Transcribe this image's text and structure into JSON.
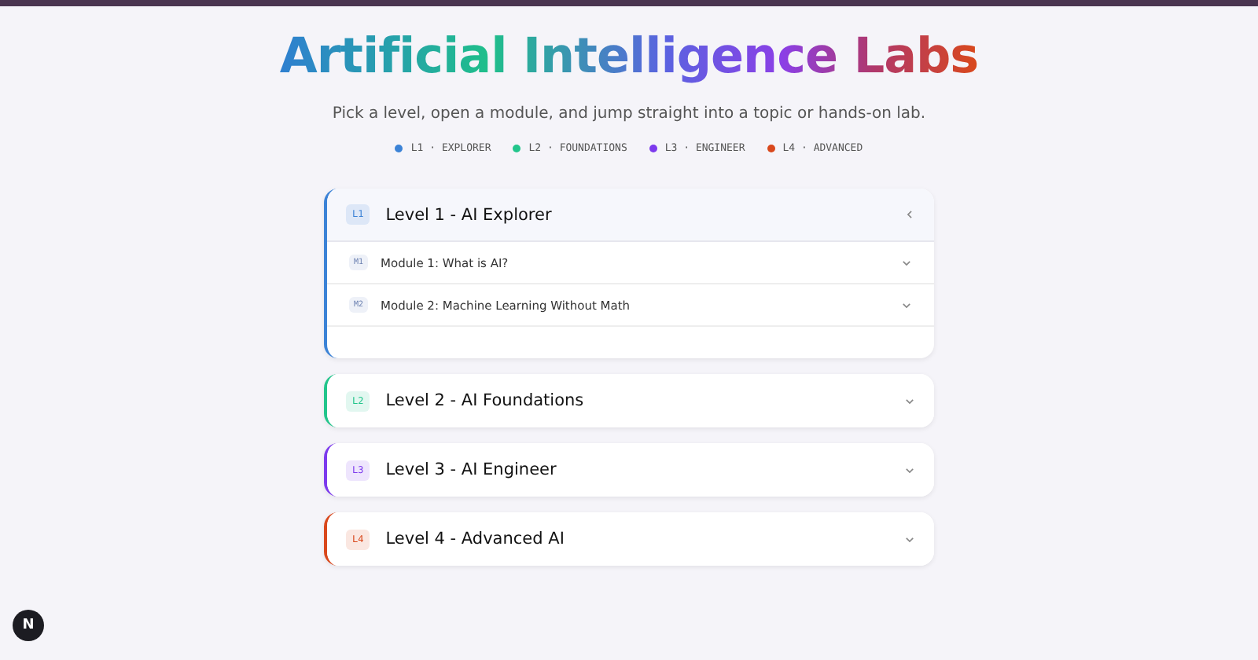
{
  "title": "Artificial Intelligence Labs",
  "subtitle": "Pick a level, open a module, and jump straight into a topic or hands-on lab.",
  "legend": [
    {
      "label": "L1 · EXPLORER",
      "color": "#3b82d6"
    },
    {
      "label": "L2 · FOUNDATIONS",
      "color": "#22c58b"
    },
    {
      "label": "L3 · ENGINEER",
      "color": "#7c3aed"
    },
    {
      "label": "L4 · ADVANCED",
      "color": "#d9481c"
    }
  ],
  "levels": [
    {
      "badge": "L1",
      "title": "Level 1 - AI Explorer",
      "color": "#3b82d6",
      "expanded": true,
      "modules": [
        {
          "badge": "M1",
          "title": "Module 1: What is AI?",
          "expanded": false
        },
        {
          "badge": "M2",
          "title": "Module 2: Machine Learning Without Math",
          "expanded": false
        }
      ]
    },
    {
      "badge": "L2",
      "title": "Level 2 - AI Foundations",
      "color": "#22c58b",
      "expanded": false
    },
    {
      "badge": "L3",
      "title": "Level 3 - AI Engineer",
      "color": "#7c3aed",
      "expanded": false
    },
    {
      "badge": "L4",
      "title": "Level 4 - Advanced AI",
      "color": "#d9481c",
      "expanded": false
    }
  ],
  "dev_badge": "N"
}
